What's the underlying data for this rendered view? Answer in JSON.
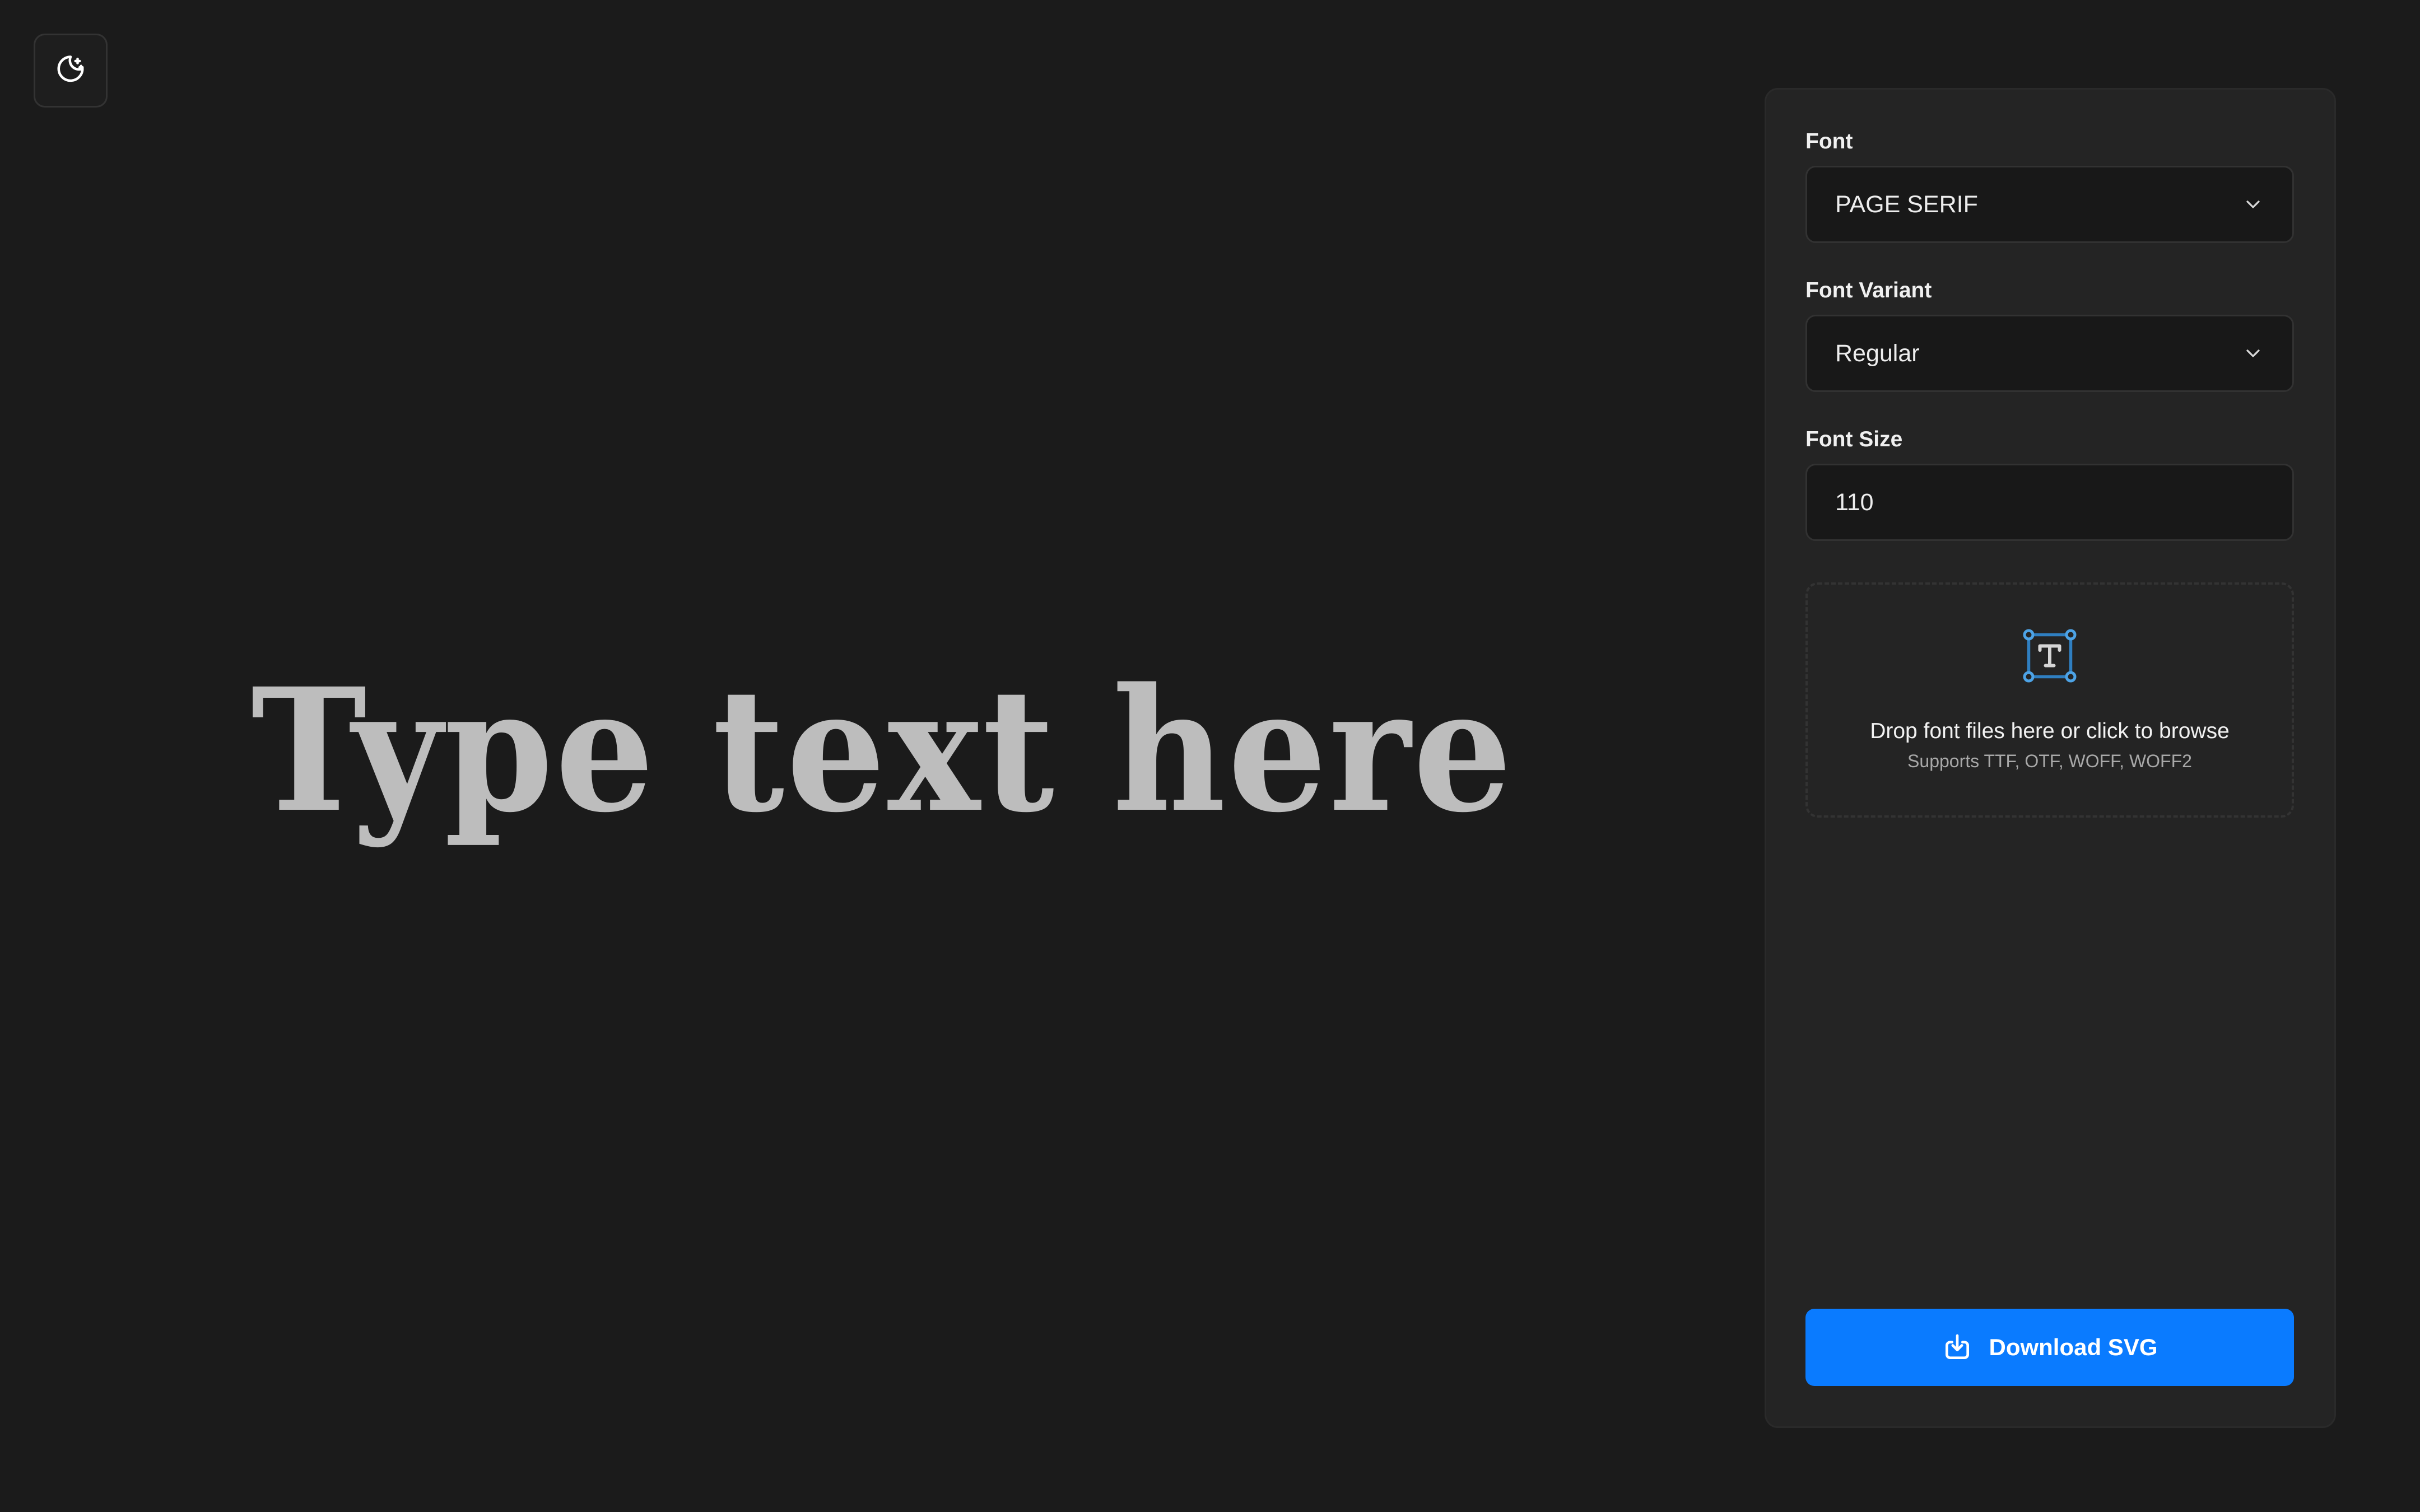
{
  "theme_toggle": {
    "icon": "moon-stars-icon"
  },
  "preview": {
    "text": "Type text here",
    "color": "#bdbdbd"
  },
  "panel": {
    "font": {
      "label": "Font",
      "value": "PAGE SERIF"
    },
    "font_variant": {
      "label": "Font Variant",
      "value": "Regular"
    },
    "font_size": {
      "label": "Font Size",
      "value": "110"
    },
    "dropzone": {
      "icon": "text-frame-icon",
      "title": "Drop font files here or click to browse",
      "subtitle": "Supports TTF, OTF, WOFF, WOFF2"
    },
    "download": {
      "label": "Download SVG",
      "icon": "download-icon",
      "color": "#0a7bff"
    }
  }
}
